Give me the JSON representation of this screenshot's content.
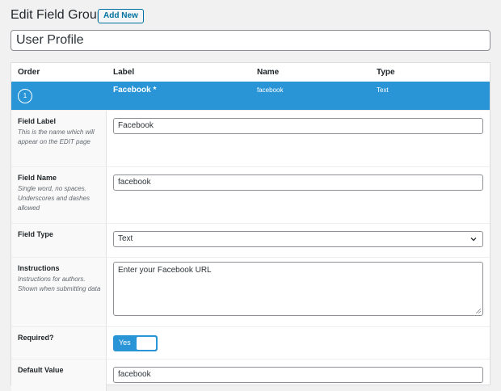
{
  "header": {
    "title": "Edit Field Group",
    "add_new_label": "Add New",
    "group_title_value": "User Profile"
  },
  "table": {
    "columns": [
      "Order",
      "Label",
      "Name",
      "Type"
    ]
  },
  "field": {
    "order": "1",
    "label": "Facebook *",
    "name": "facebook",
    "type": "Text"
  },
  "settings": {
    "field_label": {
      "label": "Field Label",
      "desc": "This is the name which will appear on the EDIT page",
      "value": "Facebook"
    },
    "field_name": {
      "label": "Field Name",
      "desc": "Single word, no spaces. Underscores and dashes allowed",
      "value": "facebook"
    },
    "field_type": {
      "label": "Field Type",
      "value": "Text"
    },
    "instructions": {
      "label": "Instructions",
      "desc": "Instructions for authors. Shown when submitting data",
      "value": "Enter your Facebook URL"
    },
    "required": {
      "label": "Required?",
      "toggle_label": "Yes",
      "checked": true
    },
    "default_value": {
      "label": "Default Value",
      "value": "facebook"
    }
  },
  "colors": {
    "accent": "#2a95d6",
    "link": "#0071a1"
  }
}
